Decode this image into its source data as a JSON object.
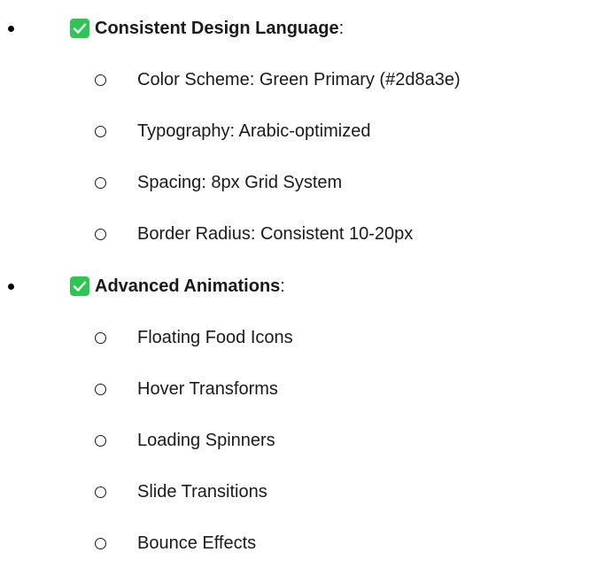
{
  "accent_color": "#2dc653",
  "icons": {
    "checkbox": "check-mark-button-icon",
    "bullet": "filled-circle-bullet",
    "sub_bullet": "hollow-circle-bullet"
  },
  "sections": [
    {
      "title": "Consistent Design Language",
      "colon": ":",
      "items": [
        "Color Scheme: Green Primary (#2d8a3e)",
        "Typography: Arabic-optimized",
        "Spacing: 8px Grid System",
        "Border Radius: Consistent 10-20px"
      ]
    },
    {
      "title": "Advanced Animations",
      "colon": ":",
      "items": [
        "Floating Food Icons",
        "Hover Transforms",
        "Loading Spinners",
        "Slide Transitions",
        "Bounce Effects"
      ]
    }
  ]
}
